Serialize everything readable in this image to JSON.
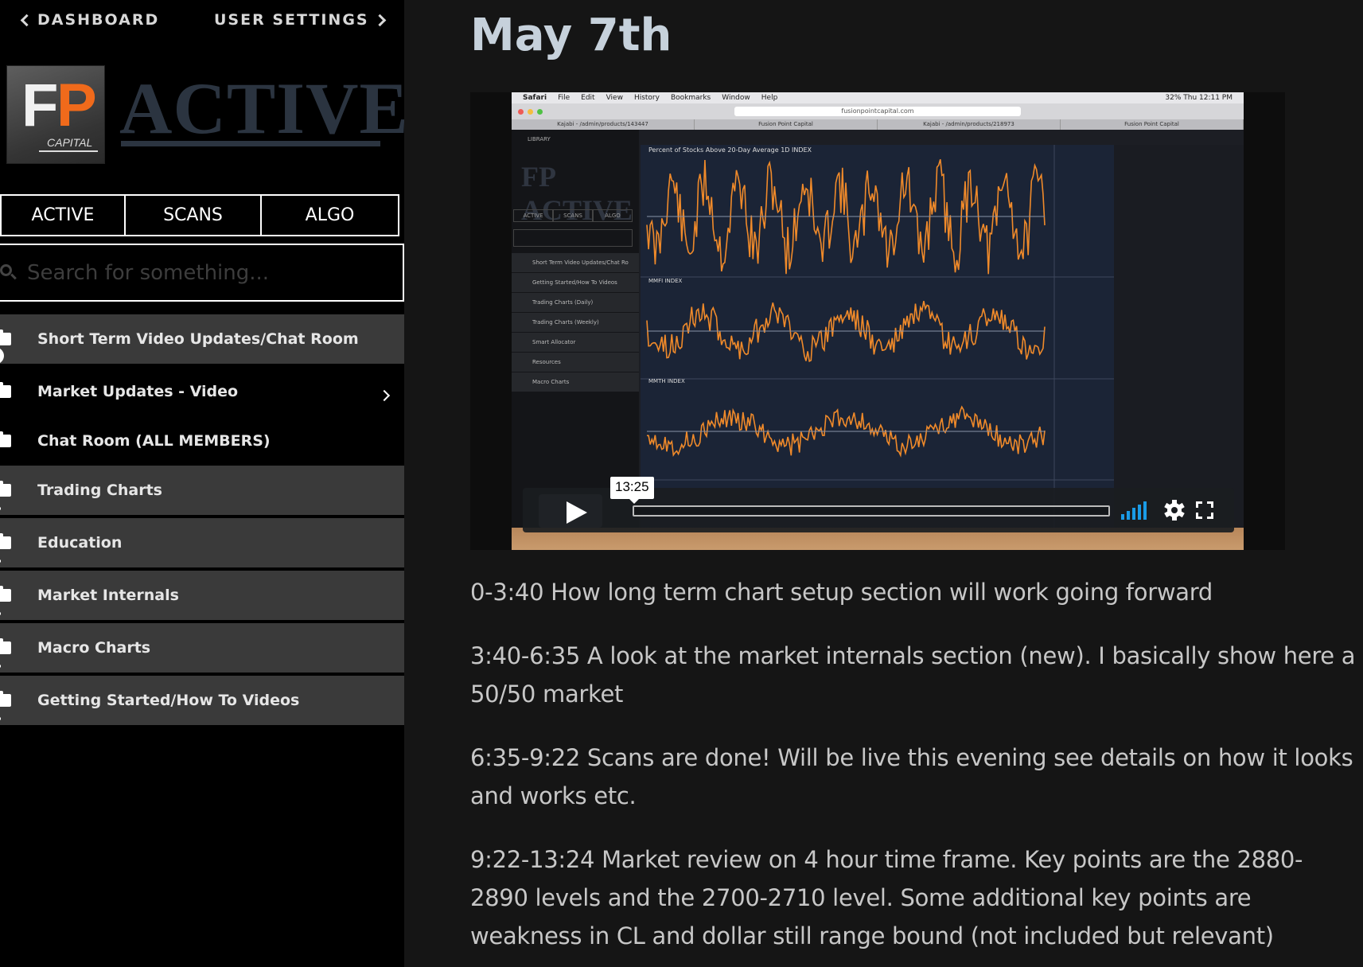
{
  "topnav": {
    "back_label": "DASHBOARD",
    "forward_label": "USER SETTINGS"
  },
  "logo": {
    "letter_f": "F",
    "letter_p": "P",
    "caption": "CAPITAL",
    "word": "ACTIVE"
  },
  "tabs": [
    {
      "label": "ACTIVE"
    },
    {
      "label": "SCANS"
    },
    {
      "label": "ALGO"
    }
  ],
  "search": {
    "placeholder": "Search for something..."
  },
  "menu": [
    {
      "label": "Short Term Video Updates/Chat Room",
      "control": "collapse"
    },
    {
      "label": "Market Updates - Video",
      "control": "chevron"
    },
    {
      "label": "Chat Room (ALL MEMBERS)",
      "control": "none"
    },
    {
      "label": "Trading Charts",
      "control": "expand"
    },
    {
      "label": "Education",
      "control": "expand"
    },
    {
      "label": "Market Internals",
      "control": "expand"
    },
    {
      "label": "Macro Charts",
      "control": "expand"
    },
    {
      "label": "Getting Started/How To Videos",
      "control": "expand"
    }
  ],
  "main": {
    "title": "May 7th",
    "video": {
      "duration": "13:25",
      "screen": {
        "menubar": [
          "Safari",
          "File",
          "Edit",
          "View",
          "History",
          "Bookmarks",
          "Window",
          "Help"
        ],
        "clock": "32%   Thu 12:11 PM",
        "url": "fusionpointcapital.com",
        "browser_tabs": [
          "Kajabi - /admin/products/143447",
          "Fusion Point Capital",
          "Kajabi - /admin/products/218973",
          "Fusion Point Capital"
        ],
        "inner_library": "LIBRARY",
        "inner_logo": "FP ACTIVE",
        "inner_tabs": [
          "ACTIVE",
          "SCANS",
          "ALGO"
        ],
        "inner_menu": [
          "Short Term Video Updates/Chat Ro",
          "Getting Started/How To Videos",
          "Trading Charts (Daily)",
          "Trading Charts (Weekly)",
          "Smart Allocator",
          "Resources",
          "Macro Charts"
        ],
        "chart_titles": [
          "Percent of Stocks Above 20-Day Average  1D  INDEX",
          "MMFI  INDEX",
          "MMTH  INDEX"
        ]
      }
    },
    "notes": [
      "0-3:40 How long term chart setup section will work going forward",
      "3:40-6:35 A look at the market internals section (new). I basically show here a 50/50 market",
      "6:35-9:22 Scans are done! Will be live this evening see details on how it looks and works etc.",
      "9:22-13:24 Market review on 4 hour time frame. Key points are the 2880-2890 levels and the 2700-2710 level. Some additional key points are weakness in CL and dollar still range bound (not included but relevant)"
    ]
  },
  "colors": {
    "accent_orange": "#f06a1b",
    "sidebar_item": "#3a3a3a",
    "signal_blue": "#1a9be6",
    "title": "#c6d1db"
  }
}
